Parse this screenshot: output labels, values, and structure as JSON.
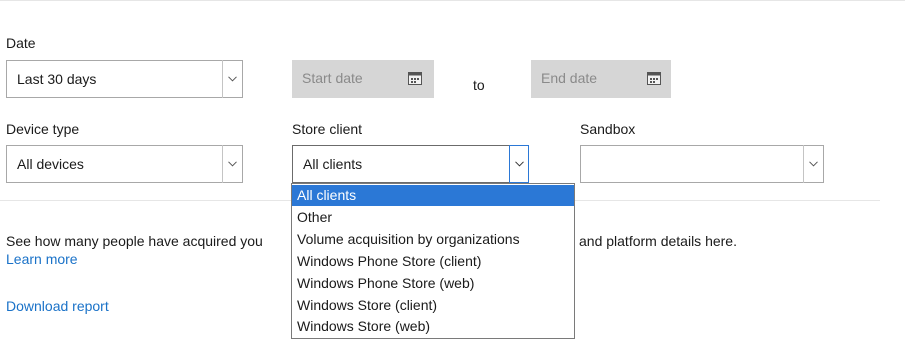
{
  "filters": {
    "date": {
      "label": "Date",
      "selected": "Last 30 days",
      "start_placeholder": "Start date",
      "to_label": "to",
      "end_placeholder": "End date"
    },
    "device_type": {
      "label": "Device type",
      "selected": "All devices"
    },
    "store_client": {
      "label": "Store client",
      "selected": "All clients",
      "options": [
        "All clients",
        "Other",
        "Volume acquisition by organizations",
        "Windows Phone Store (client)",
        "Windows Phone Store (web)",
        "Windows Store (client)",
        "Windows Store (web)"
      ],
      "highlighted_option": "All clients"
    },
    "sandbox": {
      "label": "Sandbox",
      "selected": ""
    }
  },
  "description": {
    "text_left": "See how many people have acquired you",
    "text_right": "and platform details here.",
    "learn_more": "Learn more"
  },
  "download_report": "Download report",
  "colors": {
    "accent": "#2b78d6",
    "link": "#1a72c8",
    "disabled_field": "#d6d6d6"
  }
}
